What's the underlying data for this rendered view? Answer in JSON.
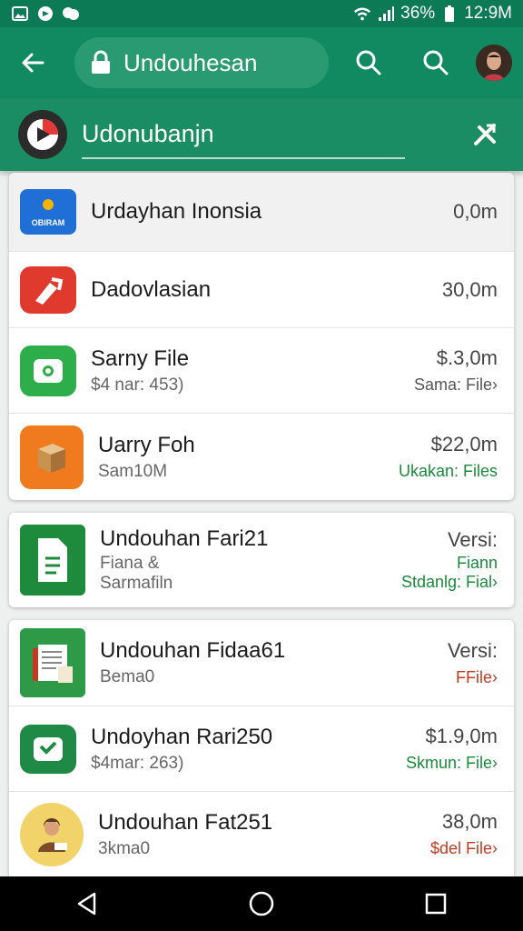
{
  "status_bar": {
    "battery": "36%",
    "time": "12:9M"
  },
  "app_bar": {
    "search_text": "Undouhesan"
  },
  "sub_bar": {
    "field_text": "Udonubanjn"
  },
  "list": {
    "items": [
      {
        "title": "Urdayhan Inonsia",
        "sub": "",
        "meta1": "0,0m",
        "meta2": "",
        "logo_text": "OBIRAM"
      },
      {
        "title": "Dadovlasian",
        "sub": "",
        "meta1": "30,0m",
        "meta2": ""
      },
      {
        "title": "Sarny File",
        "sub": "$4 nar: 453)",
        "meta1": "$.3,0m",
        "meta2": "Sama: File›"
      },
      {
        "title": "Uarry Foh",
        "sub": "Sam10M",
        "meta1": "$22,0m",
        "meta2": "Ukakan: Files"
      },
      {
        "title": "Undouhan Fari21",
        "sub": "Fiana &",
        "sub2": "Sarmafiln",
        "meta1": "Versi:",
        "meta2": "Fiann",
        "meta3": "Stdanlg: Fial›"
      },
      {
        "title": "Undouhan Fidaa61",
        "sub": "Bema0",
        "meta1": "Versi:",
        "meta2": "FFile›"
      },
      {
        "title": "Undoyhan Rari250",
        "sub": "$4mar: 263)",
        "meta1": "$1.9,0m",
        "meta2": "Skmun: File›"
      },
      {
        "title": "Undouhan Fat251",
        "sub": "3kma0",
        "meta1": "38,0m",
        "meta2": "$del File›"
      }
    ]
  },
  "colors": {
    "primary": "#128a61",
    "status_bar": "#0b7a55",
    "accent_green": "#1a8a3a",
    "accent_red": "#c23b22"
  }
}
